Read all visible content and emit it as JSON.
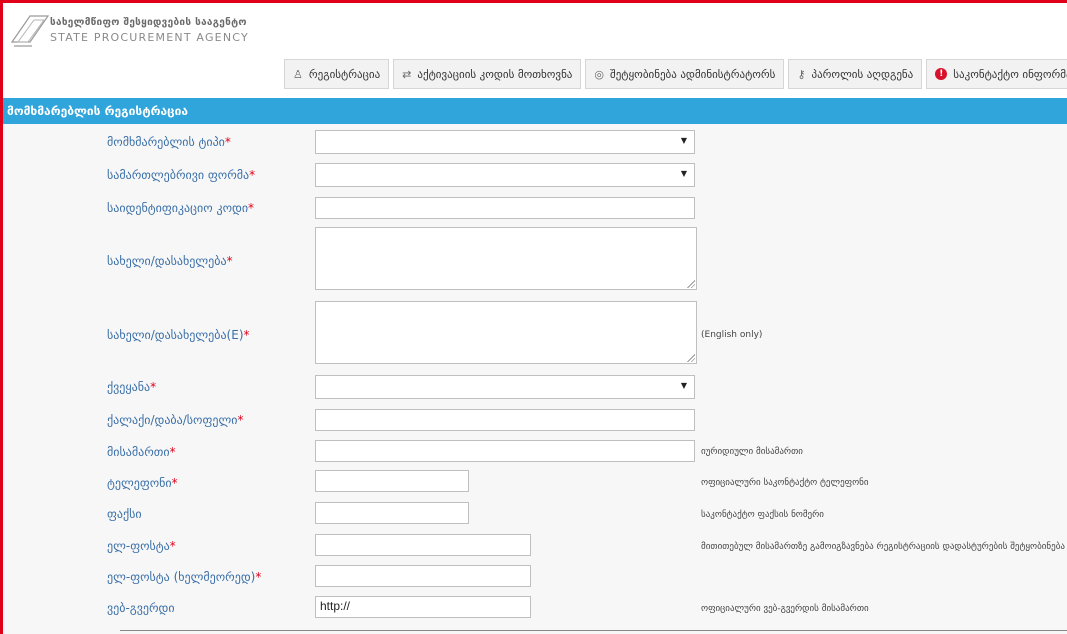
{
  "header": {
    "brand_ge": "სახელმწიფო შესყიდვების სააგენტო",
    "brand_en": "STATE PROCUREMENT AGENCY",
    "nav": [
      {
        "icon": "user-icon",
        "label": "რეგისტრაცია"
      },
      {
        "icon": "swap-arrows-icon",
        "label": "აქტივაციის კოდის მოთხოვნა"
      },
      {
        "icon": "message-icon",
        "label": "შეტყობინება ადმინისტრატორს"
      },
      {
        "icon": "key-icon",
        "label": "პაროლის აღდგენა"
      },
      {
        "icon": "info-icon",
        "label": "საკონტაქტო ინფორმაცია"
      }
    ]
  },
  "section": {
    "title": "მომხმარებლის რეგისტრაცია"
  },
  "form": {
    "user_type": {
      "label": "მომხმარებლის ტიპი",
      "req": "*",
      "value": ""
    },
    "legal_form": {
      "label": "სამართლებრივი ფორმა",
      "req": "*",
      "value": ""
    },
    "id_code": {
      "label": "საიდენტიფიკაციო კოდი",
      "req": "*",
      "value": ""
    },
    "name": {
      "label": "სახელი/დასახელება",
      "req": "*",
      "value": ""
    },
    "name_en": {
      "label": "სახელი/დასახელება(E)",
      "req": "*",
      "value": "",
      "hint": "(English only)"
    },
    "country": {
      "label": "ქვეყანა",
      "req": "*",
      "value": ""
    },
    "city": {
      "label": "ქალაქი/დაბა/სოფელი",
      "req": "*",
      "value": ""
    },
    "address": {
      "label": "მისამართი",
      "req": "*",
      "value": "",
      "hint": "იურიდიული მისამართი"
    },
    "phone": {
      "label": "ტელეფონი",
      "req": "*",
      "value": "",
      "hint": "ოფიციალური საკონტაქტო ტელეფონი"
    },
    "fax": {
      "label": "ფაქსი",
      "req": "",
      "value": "",
      "hint": "საკონტაქტო ფაქსის ნომერი"
    },
    "email": {
      "label": "ელ-ფოსტა",
      "req": "*",
      "value": "",
      "hint": "მითითებულ მისამართზე გამოიგზავნება რეგისტრაციის დადასტურების შეტყობინება"
    },
    "email_repeat": {
      "label": "ელ-ფოსტა (ხელმეორედ)",
      "req": "*",
      "value": ""
    },
    "website": {
      "label": "ვებ-გვერდი",
      "req": "",
      "value": "http://",
      "hint": "ოფიციალური ვებ-გვერდის მისამართი"
    }
  },
  "colors": {
    "accent": "#2fa5dc",
    "label": "#3a6fa8",
    "required": "#e0001a",
    "border": "#e0001a"
  }
}
